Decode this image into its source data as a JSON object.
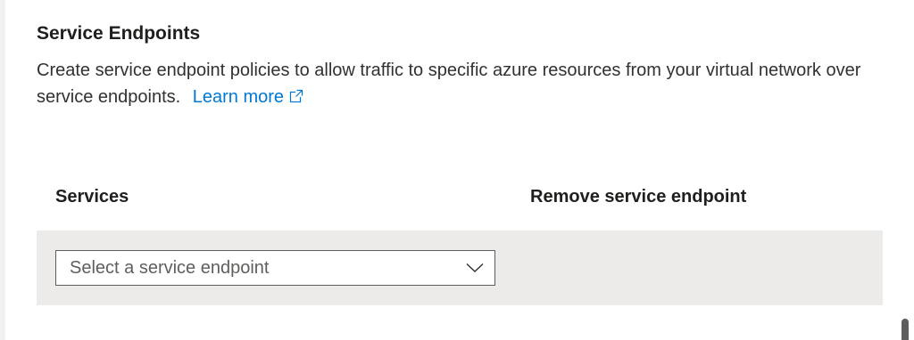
{
  "section": {
    "title": "Service Endpoints",
    "description": "Create service endpoint policies to allow traffic to specific azure resources from your virtual network over service endpoints.",
    "learn_more": "Learn more"
  },
  "table": {
    "columns": [
      "Services",
      "Remove service endpoint"
    ]
  },
  "dropdown": {
    "placeholder": "Select a service endpoint"
  },
  "icons": {
    "external_link": "external-link-icon",
    "dropdown_chevron": "chevron-down-icon"
  },
  "colors": {
    "link": "#0078d4",
    "row_background": "#edebe9",
    "text": "#323130"
  }
}
